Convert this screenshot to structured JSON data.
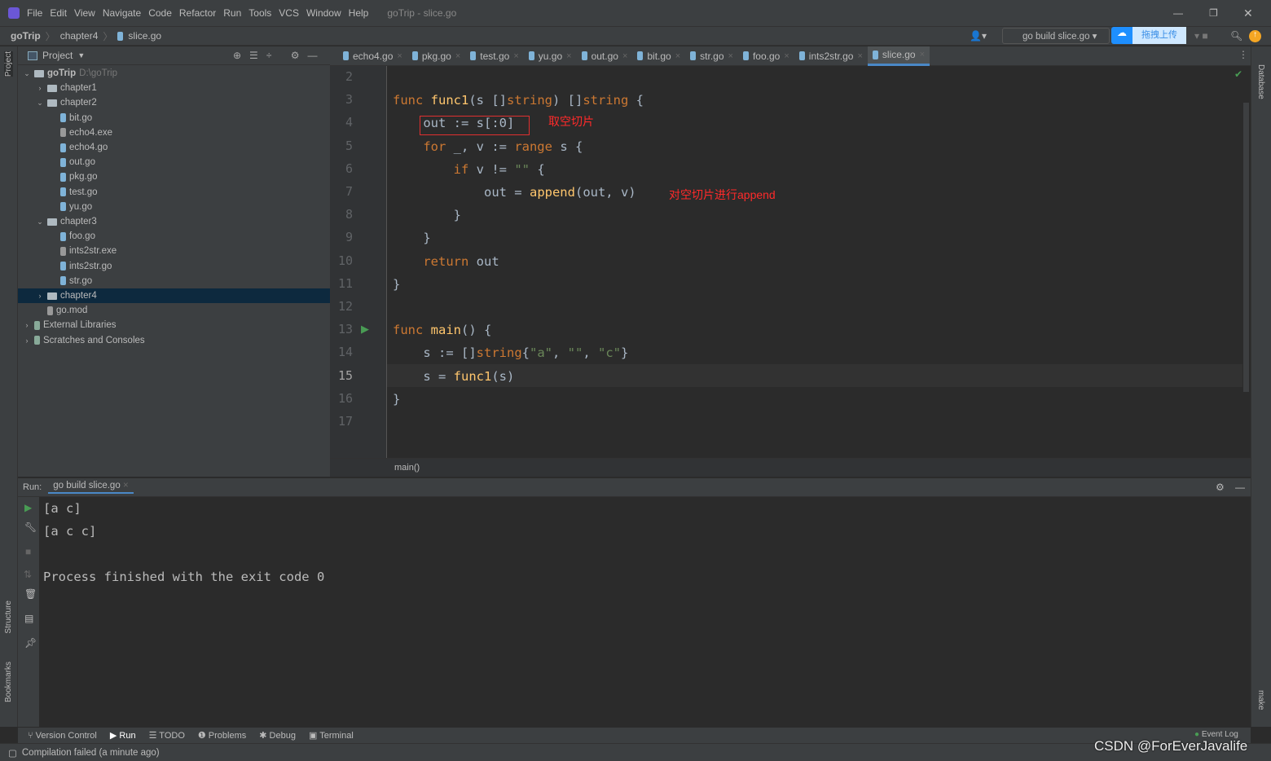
{
  "window": {
    "title": "goTrip - slice.go",
    "menu": [
      "File",
      "Edit",
      "View",
      "Navigate",
      "Code",
      "Refactor",
      "Run",
      "Tools",
      "VCS",
      "Window",
      "Help"
    ]
  },
  "breadcrumb": [
    "goTrip",
    "chapter4",
    "slice.go"
  ],
  "run_config": "go build slice.go",
  "upload_label": "拖拽上传",
  "project": {
    "title": "Project",
    "tree": [
      {
        "label": "goTrip",
        "extra": "D:\\goTrip",
        "type": "folder",
        "depth": 0,
        "open": true,
        "bold": true
      },
      {
        "label": "chapter1",
        "type": "folder",
        "depth": 1,
        "open": false
      },
      {
        "label": "chapter2",
        "type": "folder",
        "depth": 1,
        "open": true
      },
      {
        "label": "bit.go",
        "type": "go",
        "depth": 2
      },
      {
        "label": "echo4.exe",
        "type": "exe",
        "depth": 2
      },
      {
        "label": "echo4.go",
        "type": "go",
        "depth": 2
      },
      {
        "label": "out.go",
        "type": "go",
        "depth": 2
      },
      {
        "label": "pkg.go",
        "type": "go",
        "depth": 2
      },
      {
        "label": "test.go",
        "type": "go",
        "depth": 2
      },
      {
        "label": "yu.go",
        "type": "go",
        "depth": 2
      },
      {
        "label": "chapter3",
        "type": "folder",
        "depth": 1,
        "open": true
      },
      {
        "label": "foo.go",
        "type": "go",
        "depth": 2
      },
      {
        "label": "ints2str.exe",
        "type": "exe",
        "depth": 2
      },
      {
        "label": "ints2str.go",
        "type": "go",
        "depth": 2
      },
      {
        "label": "str.go",
        "type": "go",
        "depth": 2
      },
      {
        "label": "chapter4",
        "type": "folder",
        "depth": 1,
        "open": false,
        "selected": true
      },
      {
        "label": "go.mod",
        "type": "mod",
        "depth": 1
      },
      {
        "label": "External Libraries",
        "type": "lib",
        "depth": 0,
        "open": false
      },
      {
        "label": "Scratches and Consoles",
        "type": "scratch",
        "depth": 0,
        "open": false
      }
    ]
  },
  "tabs": [
    "echo4.go",
    "pkg.go",
    "test.go",
    "yu.go",
    "out.go",
    "bit.go",
    "str.go",
    "foo.go",
    "ints2str.go",
    "slice.go"
  ],
  "active_tab": "slice.go",
  "code": [
    {
      "n": "2",
      "t": []
    },
    {
      "n": "3",
      "t": [
        [
          "kw",
          "func "
        ],
        [
          "fn",
          "func1"
        ],
        [
          "tx",
          "(s []"
        ],
        [
          "kw",
          "string"
        ],
        [
          "tx",
          ") []"
        ],
        [
          "kw",
          "string"
        ],
        [
          "tx",
          " {"
        ]
      ]
    },
    {
      "n": "4",
      "t": [
        [
          "tx",
          "    out := s[:0]"
        ]
      ]
    },
    {
      "n": "5",
      "t": [
        [
          "tx",
          "    "
        ],
        [
          "kw",
          "for "
        ],
        [
          "tx",
          "_, v := "
        ],
        [
          "kw",
          "range"
        ],
        [
          "tx",
          " s {"
        ]
      ]
    },
    {
      "n": "6",
      "t": [
        [
          "tx",
          "        "
        ],
        [
          "kw",
          "if "
        ],
        [
          "tx",
          "v != "
        ],
        [
          "str",
          "\"\""
        ],
        [
          "tx",
          " {"
        ]
      ]
    },
    {
      "n": "7",
      "t": [
        [
          "tx",
          "            out = "
        ],
        [
          "fn",
          "append"
        ],
        [
          "tx",
          "(out, v)"
        ]
      ]
    },
    {
      "n": "8",
      "t": [
        [
          "tx",
          "        }"
        ]
      ]
    },
    {
      "n": "9",
      "t": [
        [
          "tx",
          "    }"
        ]
      ]
    },
    {
      "n": "10",
      "t": [
        [
          "tx",
          "    "
        ],
        [
          "kw",
          "return "
        ],
        [
          "tx",
          "out"
        ]
      ]
    },
    {
      "n": "11",
      "t": [
        [
          "tx",
          "}"
        ]
      ]
    },
    {
      "n": "12",
      "t": []
    },
    {
      "n": "13",
      "t": [
        [
          "kw",
          "func "
        ],
        [
          "fn",
          "main"
        ],
        [
          "tx",
          "() {"
        ]
      ]
    },
    {
      "n": "14",
      "t": [
        [
          "tx",
          "    s := []"
        ],
        [
          "kw",
          "string"
        ],
        [
          "tx",
          "{"
        ],
        [
          "str",
          "\"a\""
        ],
        [
          "tx",
          ", "
        ],
        [
          "str",
          "\"\""
        ],
        [
          "tx",
          ", "
        ],
        [
          "str",
          "\"c\""
        ],
        [
          "tx",
          "}"
        ]
      ]
    },
    {
      "n": "15",
      "t": [
        [
          "tx",
          "    s = "
        ],
        [
          "fn",
          "func1"
        ],
        [
          "tx",
          "(s)"
        ]
      ]
    },
    {
      "n": "16",
      "t": [
        [
          "tx",
          "}"
        ]
      ]
    },
    {
      "n": "17",
      "t": []
    }
  ],
  "annotations": [
    "取空切片",
    "对空切片进行append"
  ],
  "editor_breadcrumb": "main()",
  "run": {
    "label": "Run:",
    "tab": "go build slice.go",
    "output": [
      "[a c]",
      "[a c c]",
      "",
      "Process finished with the exit code 0"
    ]
  },
  "bottom_tools": [
    "Version Control",
    "Run",
    "TODO",
    "Problems",
    "Debug",
    "Terminal"
  ],
  "side_left": [
    "Project",
    "Structure",
    "Bookmarks"
  ],
  "side_right": [
    "Database",
    "make"
  ],
  "event_log": "Event Log",
  "status": "Compilation failed (a minute ago)",
  "watermark": "CSDN @ForEverJavalife",
  "colors": {
    "keyword": "#cc7832",
    "function": "#ffc66d",
    "string": "#6a8759",
    "annotation": "#ff2a2a",
    "accent": "#4a88c7"
  }
}
